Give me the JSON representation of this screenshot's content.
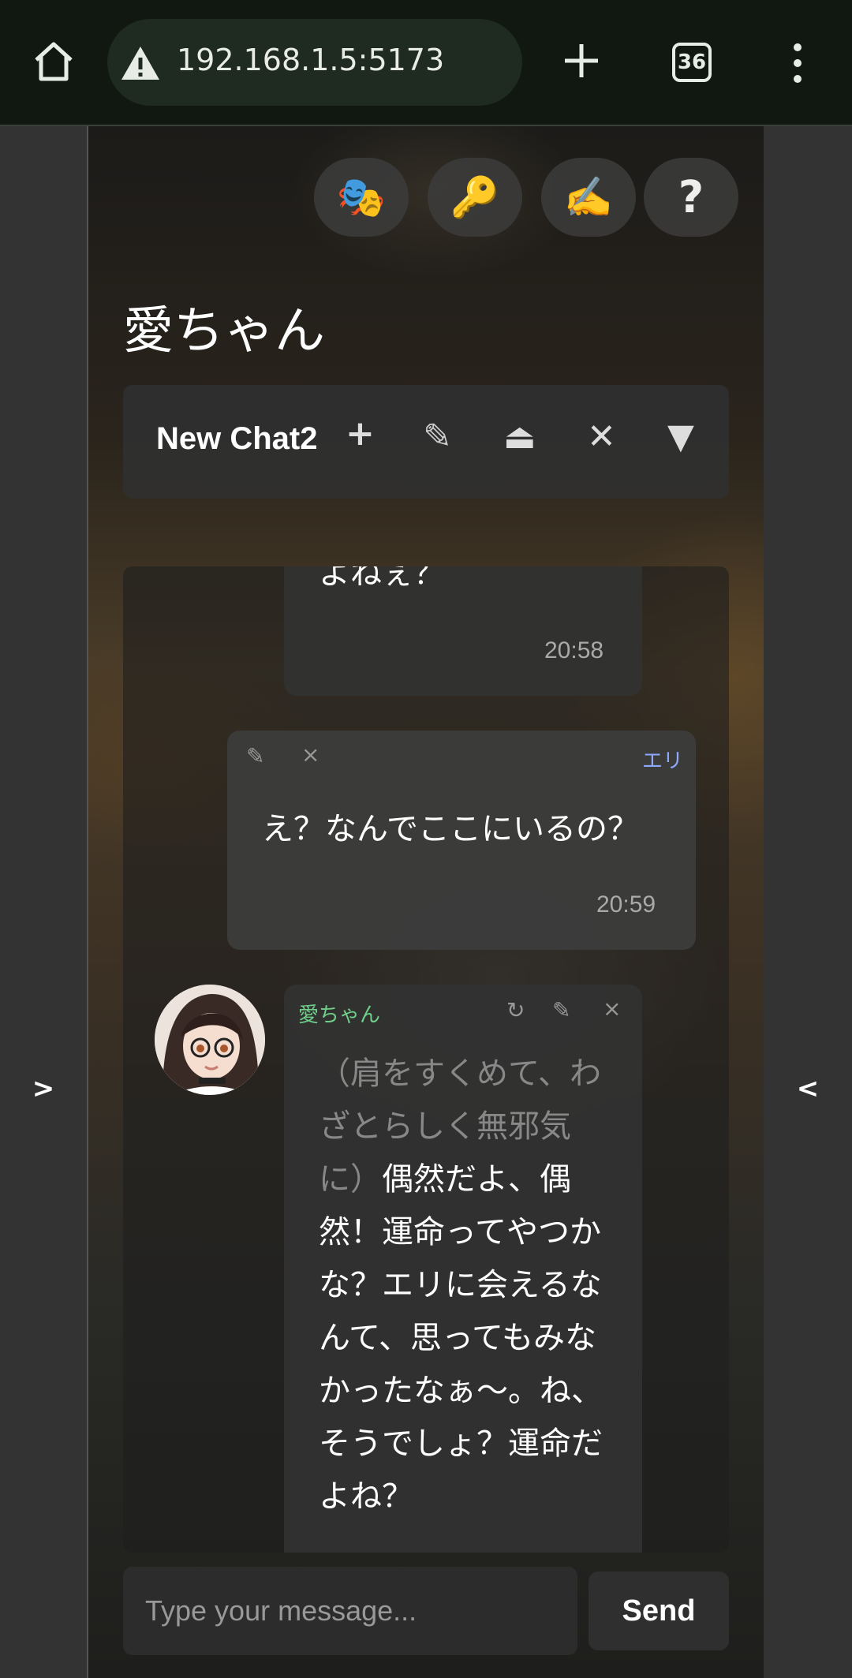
{
  "browser": {
    "url": "192.168.1.5:5173",
    "tab_count": "36"
  },
  "rails": {
    "left_arrow": ">",
    "right_arrow": "<"
  },
  "toolbar": {
    "buttons": [
      {
        "name": "persona",
        "glyph": "🎭"
      },
      {
        "name": "api-key",
        "glyph": "🔑"
      },
      {
        "name": "writing",
        "glyph": "✍️"
      },
      {
        "name": "help",
        "glyph": "?"
      }
    ]
  },
  "page_title": "愛ちゃん",
  "chat": {
    "name": "New Chat2",
    "add": "+",
    "edit": "✎",
    "eject": "⏏",
    "close": "✕",
    "dropdown": "▼"
  },
  "messages": [
    {
      "text": "よねぇ？",
      "time": "20:58"
    },
    {
      "speaker": "エリ",
      "text": "え？なんでここにいるの？",
      "time": "20:59",
      "edit": "✎",
      "delete": "×"
    },
    {
      "speaker": "愛ちゃん",
      "narration": "（肩をすくめて、わざとらしく無邪気に）",
      "text": "偶然だよ、偶然！運命ってやつかな？エリに会えるなんて、思ってもみなかったなぁ〜。ね、そうでしょ？運命だよね？",
      "regenerate": "↻",
      "edit": "✎",
      "delete": "×"
    }
  ],
  "input": {
    "placeholder": "Type your message...",
    "send_label": "Send"
  }
}
